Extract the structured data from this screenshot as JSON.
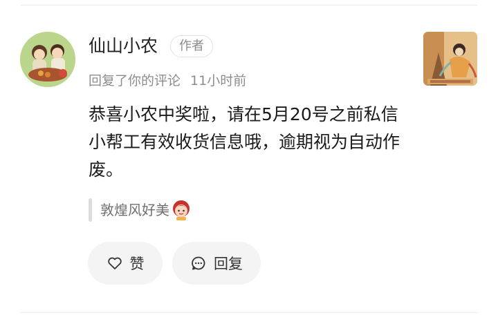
{
  "comment": {
    "username": "仙山小农",
    "author_badge": "作者",
    "action_text": "回复了你的评论",
    "time": "11小时前",
    "content": "恭喜小农中奖啦，请在5月20号之前私信小帮工有效收货信息哦，逾期视为自动作废。",
    "quote": "敦煌风好美",
    "quote_emoji": "woman-emoji-icon",
    "thumbnail_icon": "dunhuang-artwork-thumbnail"
  },
  "actions": {
    "like_label": "赞",
    "reply_label": "回复"
  },
  "colors": {
    "text_primary": "#1a1a1a",
    "text_secondary": "#8c8c8c",
    "button_bg": "#f4f4f4",
    "divider": "#ececec"
  }
}
